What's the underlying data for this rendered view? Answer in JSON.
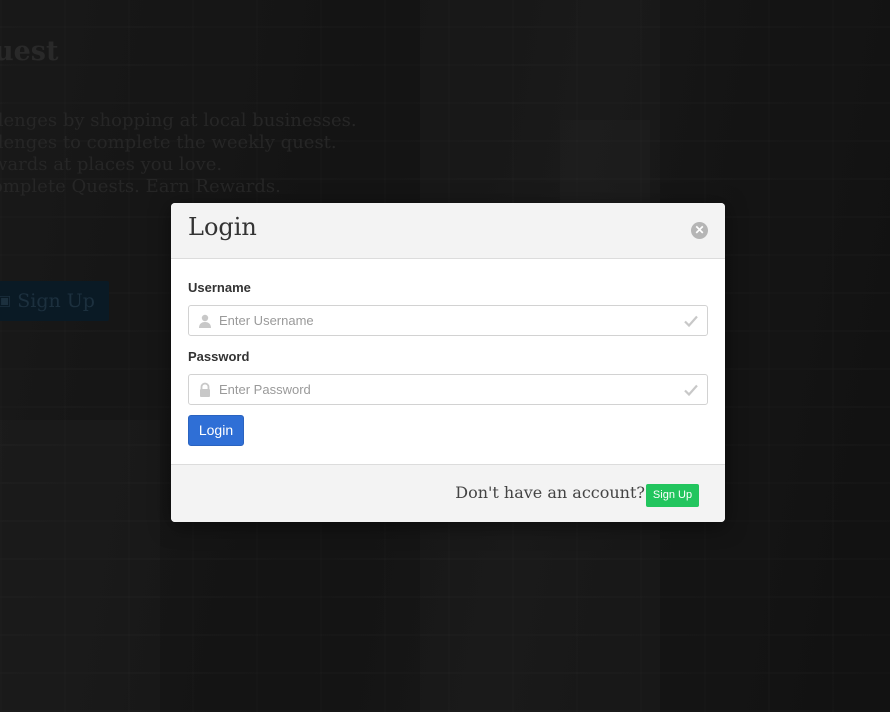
{
  "background": {
    "hero_title": "uest",
    "hero_lines": [
      "llenges by shopping at local businesses.",
      "llenges to complete the weekly quest.",
      "wards at places you love.",
      "omplete Quests. Earn Rewards."
    ],
    "signup_label": "Sign Up",
    "signup_icon": "sign-in-icon"
  },
  "modal": {
    "title": "Login",
    "close_icon": "close-circle-icon",
    "username": {
      "label": "Username",
      "placeholder": "Enter Username",
      "value": "",
      "icon": "user-icon",
      "status_icon": "check-icon"
    },
    "password": {
      "label": "Password",
      "placeholder": "Enter Password",
      "value": "",
      "icon": "lock-icon",
      "status_icon": "check-icon"
    },
    "login_button": "Login",
    "footer": {
      "prompt": "Don't have an account?",
      "signup_button": "Sign Up"
    }
  },
  "colors": {
    "primary": "#2f6fd6",
    "success": "#22c55e",
    "header_bg": "#f3f3f3"
  }
}
